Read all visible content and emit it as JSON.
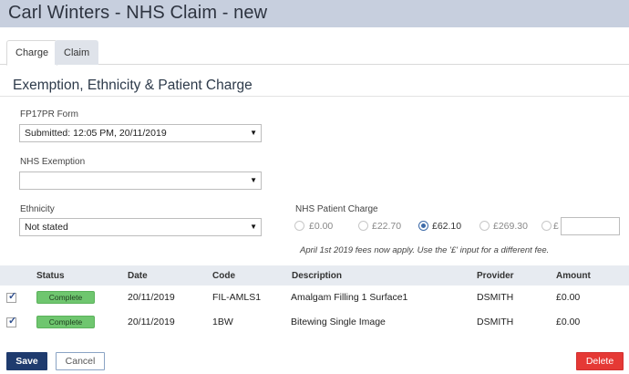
{
  "window": {
    "title": "Carl Winters - NHS Claim - new"
  },
  "tabs": [
    {
      "label": "Charge",
      "active": true
    },
    {
      "label": "Claim",
      "active": false
    }
  ],
  "section": {
    "title": "Exemption, Ethnicity & Patient Charge"
  },
  "fp17pr": {
    "label": "FP17PR Form",
    "value": "Submitted: 12:05 PM, 20/11/2019"
  },
  "exemption": {
    "label": "NHS Exemption",
    "value": ""
  },
  "ethnicity": {
    "label": "Ethnicity",
    "value": "Not stated"
  },
  "patient_charge": {
    "label": "NHS Patient Charge",
    "options": [
      {
        "label": "£0.00",
        "selected": false
      },
      {
        "label": "£22.70",
        "selected": false
      },
      {
        "label": "£62.10",
        "selected": true
      },
      {
        "label": "£269.30",
        "selected": false
      },
      {
        "label": "£",
        "selected": false
      }
    ],
    "custom_value": "",
    "note": "April 1st 2019 fees now apply. Use the '£' input for a different fee."
  },
  "table": {
    "headers": {
      "status": "Status",
      "date": "Date",
      "code": "Code",
      "description": "Description",
      "provider": "Provider",
      "amount": "Amount"
    },
    "rows": [
      {
        "checked": true,
        "status": "Complete",
        "date": "20/11/2019",
        "code": "FIL-AMLS1",
        "description": "Amalgam Filling 1 Surface1",
        "provider": "DSMITH",
        "amount": "£0.00"
      },
      {
        "checked": true,
        "status": "Complete",
        "date": "20/11/2019",
        "code": "1BW",
        "description": "Bitewing Single Image",
        "provider": "DSMITH",
        "amount": "£0.00"
      }
    ]
  },
  "actions": {
    "save": "Save",
    "cancel": "Cancel",
    "delete": "Delete"
  },
  "colors": {
    "titlebar": "#c7cfde",
    "save": "#1f3b6e",
    "delete": "#e53935",
    "complete": "#6fc66f"
  },
  "icons": {
    "checkbox_tick": "✓",
    "dropdown": "▼"
  }
}
